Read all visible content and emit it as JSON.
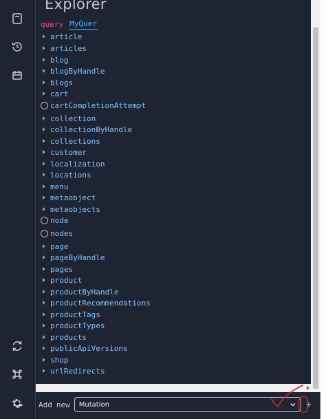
{
  "rail": {
    "icons": [
      "docs-icon",
      "history-icon",
      "plugin-icon",
      "refresh-icon",
      "shortcut-icon",
      "settings-icon"
    ]
  },
  "explorer": {
    "title": "Explorer",
    "query_keyword": "query",
    "query_name": "MyQuer"
  },
  "fields": [
    {
      "label": "article",
      "kind": "caret"
    },
    {
      "label": "articles",
      "kind": "caret"
    },
    {
      "label": "blog",
      "kind": "caret"
    },
    {
      "label": "blogByHandle",
      "kind": "caret"
    },
    {
      "label": "blogs",
      "kind": "caret"
    },
    {
      "label": "cart",
      "kind": "caret"
    },
    {
      "label": "cartCompletionAttempt",
      "kind": "radio"
    },
    {
      "label": "collection",
      "kind": "caret"
    },
    {
      "label": "collectionByHandle",
      "kind": "caret"
    },
    {
      "label": "collections",
      "kind": "caret"
    },
    {
      "label": "customer",
      "kind": "caret"
    },
    {
      "label": "localization",
      "kind": "caret"
    },
    {
      "label": "locations",
      "kind": "caret"
    },
    {
      "label": "menu",
      "kind": "caret"
    },
    {
      "label": "metaobject",
      "kind": "caret"
    },
    {
      "label": "metaobjects",
      "kind": "caret"
    },
    {
      "label": "node",
      "kind": "radio"
    },
    {
      "label": "nodes",
      "kind": "radio"
    },
    {
      "label": "page",
      "kind": "caret"
    },
    {
      "label": "pageByHandle",
      "kind": "caret"
    },
    {
      "label": "pages",
      "kind": "caret"
    },
    {
      "label": "product",
      "kind": "caret"
    },
    {
      "label": "productByHandle",
      "kind": "caret"
    },
    {
      "label": "productRecommendations",
      "kind": "caret"
    },
    {
      "label": "productTags",
      "kind": "caret"
    },
    {
      "label": "productTypes",
      "kind": "caret"
    },
    {
      "label": "products",
      "kind": "caret"
    },
    {
      "label": "publicApiVersions",
      "kind": "caret"
    },
    {
      "label": "shop",
      "kind": "caret"
    },
    {
      "label": "urlRedirects",
      "kind": "caret"
    }
  ],
  "footer": {
    "add_label": "Add",
    "new_label": "new",
    "operation": "Mutation",
    "add_button": "+"
  },
  "colors": {
    "background": "#1f2432",
    "keyword": "#e8507a",
    "field": "#7fc4ff",
    "annotation": "#e0202a"
  }
}
